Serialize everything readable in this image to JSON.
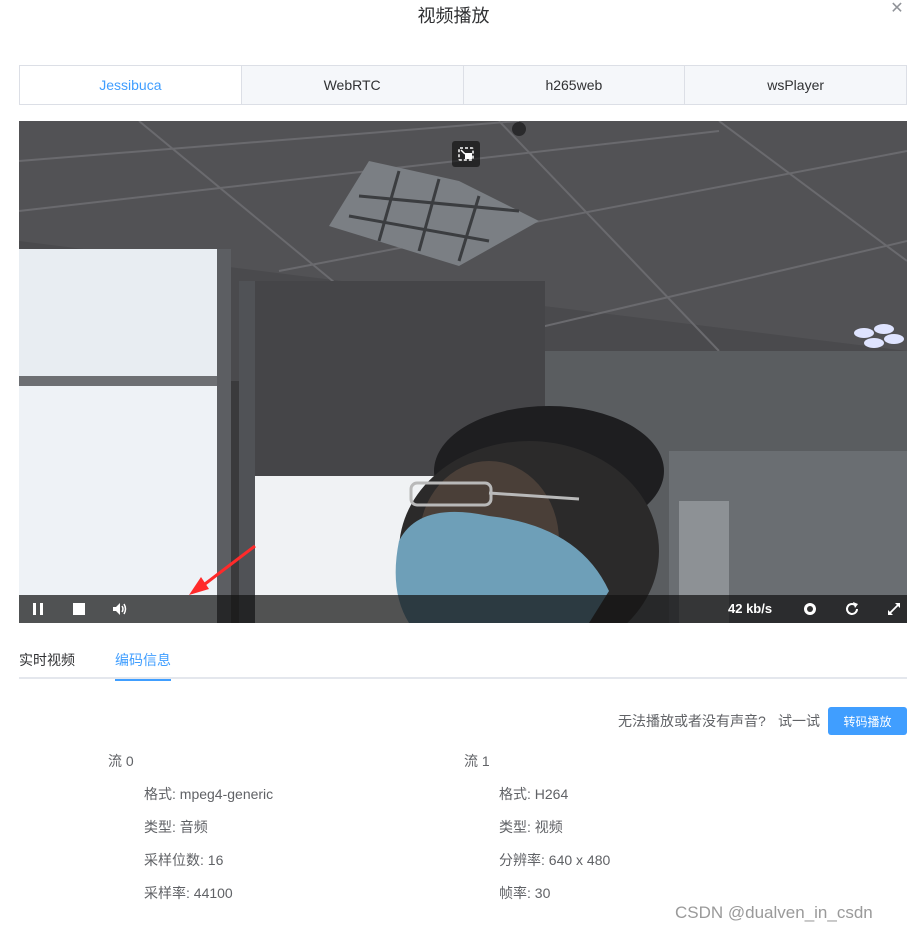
{
  "dialog": {
    "title": "视频播放",
    "close_icon": "close-icon"
  },
  "player_tabs": [
    {
      "label": "Jessibuca",
      "active": true
    },
    {
      "label": "WebRTC",
      "active": false
    },
    {
      "label": "h265web",
      "active": false
    },
    {
      "label": "wsPlayer",
      "active": false
    }
  ],
  "player": {
    "bitrate": "42 kb/s",
    "controls": [
      "pause-icon",
      "stop-icon",
      "volume-icon",
      "screenshot-icon",
      "refresh-icon",
      "fullscreen-icon",
      "pip-icon"
    ]
  },
  "info_tabs": [
    {
      "label": "实时视频",
      "active": false
    },
    {
      "label": "编码信息",
      "active": true
    }
  ],
  "transcode": {
    "hint": "无法播放或者没有声音?",
    "try_label": "试一试",
    "button_label": "转码播放"
  },
  "streams": [
    {
      "title": "流 0",
      "rows": [
        "格式: mpeg4-generic",
        "类型: 音频",
        "采样位数: 16",
        "采样率: 44100"
      ]
    },
    {
      "title": "流 1",
      "rows": [
        "格式: H264",
        "类型: 视频",
        "分辨率: 640 x 480",
        "帧率: 30"
      ]
    }
  ],
  "watermark": "CSDN @dualven_in_csdn",
  "colors": {
    "accent": "#409eff",
    "annotation_arrow": "#ff2a2a"
  }
}
